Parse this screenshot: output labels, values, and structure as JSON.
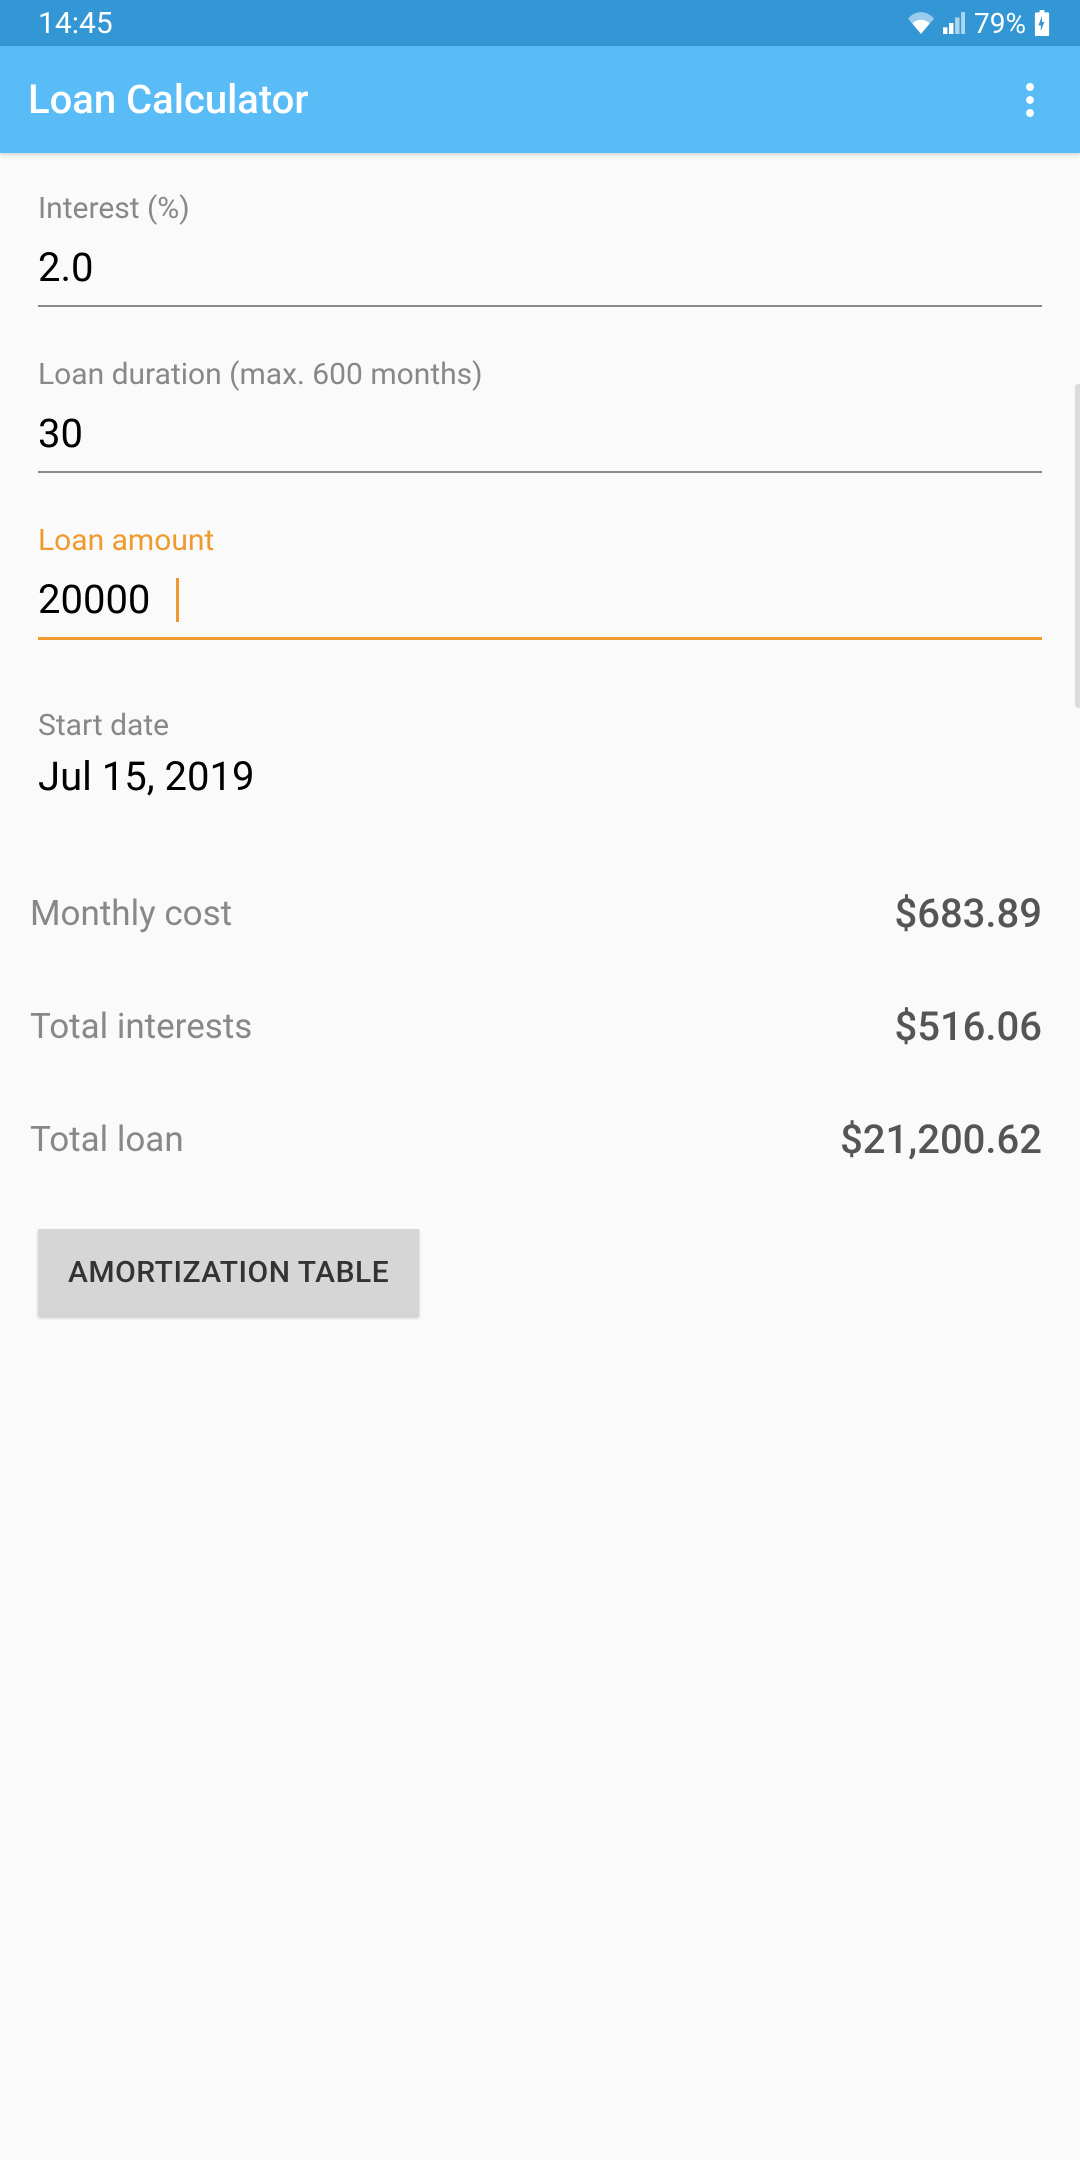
{
  "statusBar": {
    "time": "14:45",
    "battery": "79%"
  },
  "appBar": {
    "title": "Loan Calculator"
  },
  "fields": {
    "interest": {
      "label": "Interest (%)",
      "value": "2.0"
    },
    "duration": {
      "label": "Loan duration (max. 600 months)",
      "value": "30"
    },
    "amount": {
      "label": "Loan amount",
      "value": "20000"
    },
    "startDate": {
      "label": "Start date",
      "value": "Jul 15, 2019"
    }
  },
  "results": {
    "monthlyCost": {
      "label": "Monthly cost",
      "value": "$683.89"
    },
    "totalInterests": {
      "label": "Total interests",
      "value": "$516.06"
    },
    "totalLoan": {
      "label": "Total loan",
      "value": "$21,200.62"
    }
  },
  "buttons": {
    "amortization": "AMORTIZATION TABLE"
  }
}
